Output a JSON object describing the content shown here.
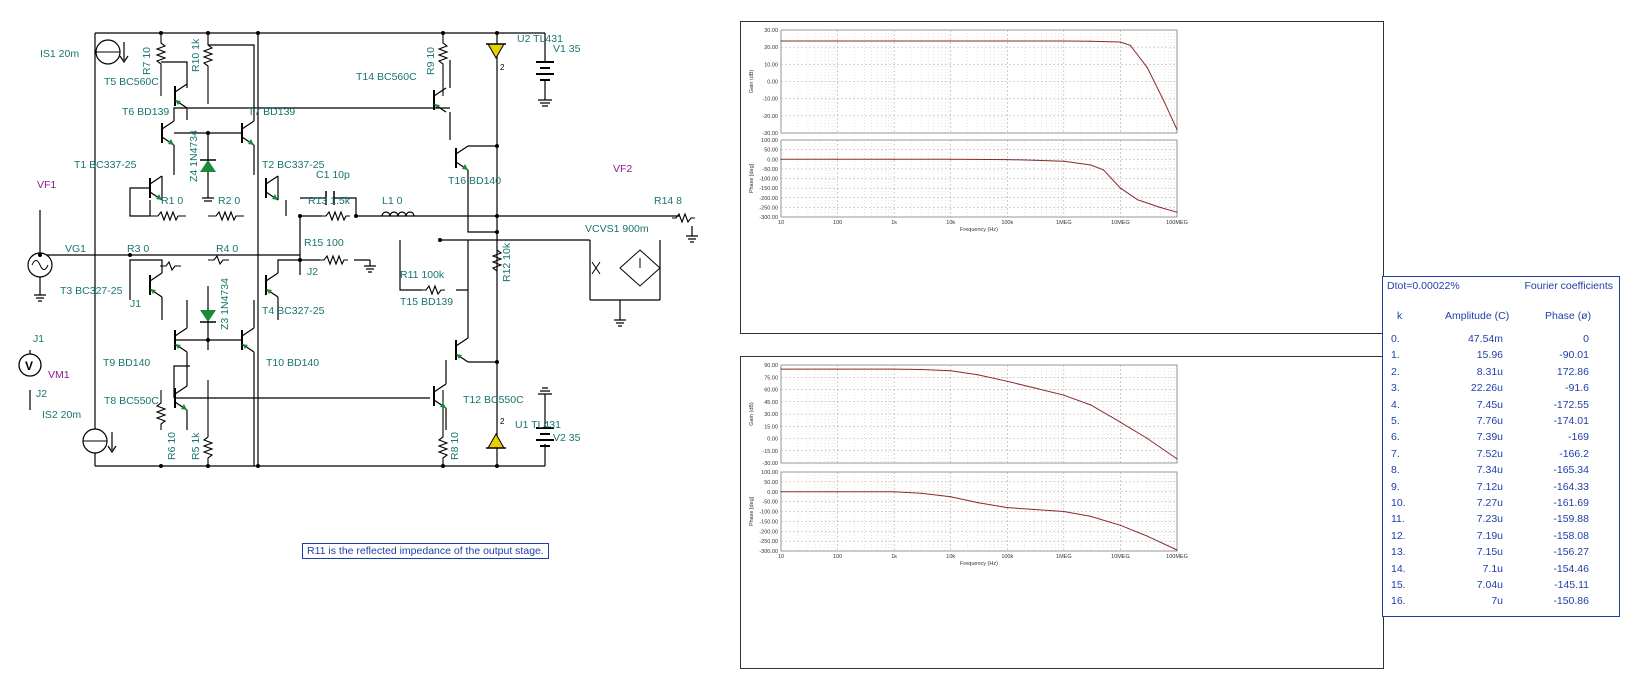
{
  "schematic": {
    "labels": {
      "is1": "IS1 20m",
      "is2": "IS2 20m",
      "r7": "R7 10",
      "r10": "R10 1k",
      "r9": "R9 10",
      "u2": "U2 TL431",
      "v1": "V1 35",
      "t5": "T5 BC560C",
      "t14": "T14 BC560C",
      "t6": "T6 BD139",
      "t7": "T7 BD139",
      "z4": "Z4 1N4734",
      "t1": "T1 BC337-25",
      "t2": "T2 BC337-25",
      "vf1": "VF1",
      "vf2": "VF2",
      "r1": "R1 0",
      "r2": "R2 0",
      "c1": "C1 10p",
      "r13": "R13 1.5k",
      "l1": "L1 0",
      "r14": "R14 8",
      "t16": "T16 BD140",
      "vg1": "VG1",
      "r3": "R3 0",
      "r4": "R4 0",
      "r15": "R15 100",
      "j2a": "J2",
      "vcvs": "VCVS1 900m",
      "r12": "R12 10k",
      "r11": "R11 100k",
      "t3": "T3 BC327-25",
      "z3": "Z3 1N4734",
      "t4": "T4 BC327-25",
      "j1a": "J1",
      "t15": "T15 BD139",
      "j1b": "J1",
      "vm1": "VM1",
      "vm_symbol": "V",
      "j2b": "J2",
      "t9": "T9 BD140",
      "t10": "T10 BD140",
      "t12": "T12 BC550C",
      "t8": "T8 BC550C",
      "u1": "U1 TL431",
      "v2": "V2 35",
      "r6": "R6 10",
      "r5": "R5 1k",
      "r8": "R8 10",
      "pin2a": "2",
      "pin2b": "2"
    },
    "note": "R11 is the reflected impedance of the output stage."
  },
  "bode_top": {
    "gain_label": "Gain (dB)",
    "phase_label": "Phase [deg]",
    "xlabel": "Frequency (Hz)",
    "x_ticks": [
      "10",
      "100",
      "1k",
      "10k",
      "100k",
      "1MEG",
      "10MEG",
      "100MEG"
    ],
    "gain_ticks": [
      "30.00",
      "20.00",
      "10.00",
      "0.00",
      "-10.00",
      "-20.00",
      "-30.00"
    ],
    "phase_ticks": [
      "100.00",
      "50.00",
      "0.00",
      "-50.00",
      "-100.00",
      "-150.00",
      "-200.00",
      "-250.00",
      "-300.00"
    ],
    "line_color": "#8b2a2a"
  },
  "bode_bottom": {
    "gain_label": "Gain (dB)",
    "phase_label": "Phase [deg]",
    "xlabel": "Frequency (Hz)",
    "x_ticks": [
      "10",
      "100",
      "1k",
      "10k",
      "100k",
      "1MEG",
      "10MEG",
      "100MEG"
    ],
    "gain_ticks": [
      "90.00",
      "75.00",
      "60.00",
      "45.00",
      "30.00",
      "15.00",
      "0.00",
      "-15.00",
      "-30.00"
    ],
    "phase_ticks": [
      "100.00",
      "50.00",
      "0.00",
      "-50.00",
      "-100.00",
      "-150.00",
      "-200.00",
      "-250.00",
      "-300.00"
    ],
    "line_color": "#8b2a2a"
  },
  "chart_data": [
    {
      "type": "line",
      "title": "",
      "xlabel": "Frequency (Hz)",
      "ylabel": "Gain (dB)",
      "xscale": "log",
      "xlim": [
        10,
        100000000
      ],
      "ylim": [
        -30,
        30
      ],
      "grid": true,
      "x": [
        10,
        100,
        1000,
        10000,
        100000,
        1000000,
        3000000,
        10000000,
        15000000,
        30000000,
        60000000,
        100000000
      ],
      "series": [
        {
          "values": [
            23.6,
            23.6,
            23.6,
            23.6,
            23.6,
            23.6,
            23.4,
            23.0,
            21.0,
            8.0,
            -12.0,
            -28.0
          ]
        }
      ]
    },
    {
      "type": "line",
      "title": "",
      "xlabel": "Frequency (Hz)",
      "ylabel": "Phase [deg]",
      "xscale": "log",
      "xlim": [
        10,
        100000000
      ],
      "ylim": [
        -300,
        100
      ],
      "grid": true,
      "x": [
        10,
        100,
        1000,
        10000,
        100000,
        300000,
        1000000,
        3000000,
        5000000,
        10000000,
        20000000,
        50000000,
        100000000
      ],
      "series": [
        {
          "values": [
            0,
            0,
            0,
            0,
            -2,
            -5,
            -10,
            -30,
            -55,
            -150,
            -210,
            -250,
            -275
          ]
        }
      ]
    },
    {
      "type": "line",
      "title": "",
      "xlabel": "Frequency (Hz)",
      "ylabel": "Gain (dB)",
      "xscale": "log",
      "xlim": [
        10,
        100000000
      ],
      "ylim": [
        -30,
        90
      ],
      "grid": true,
      "x": [
        10,
        100,
        1000,
        3000,
        10000,
        30000,
        100000,
        300000,
        1000000,
        3000000,
        10000000,
        30000000,
        100000000
      ],
      "series": [
        {
          "values": [
            85,
            85,
            85,
            84.5,
            83,
            78,
            70,
            62,
            53,
            41,
            20,
            0,
            -25
          ]
        }
      ]
    },
    {
      "type": "line",
      "title": "",
      "xlabel": "Frequency (Hz)",
      "ylabel": "Phase [deg]",
      "xscale": "log",
      "xlim": [
        10,
        100000000
      ],
      "ylim": [
        -300,
        100
      ],
      "grid": true,
      "x": [
        10,
        100,
        1000,
        3000,
        10000,
        30000,
        100000,
        300000,
        1000000,
        3000000,
        10000000,
        30000000,
        100000000
      ],
      "series": [
        {
          "values": [
            0,
            0,
            0,
            -8,
            -25,
            -55,
            -80,
            -90,
            -100,
            -125,
            -170,
            -225,
            -295
          ]
        }
      ]
    }
  ],
  "fourier": {
    "dtot": "Dtot=0.00022%",
    "title": "Fourier coefficients",
    "col_k": "k",
    "col_amp": "Amplitude (C)",
    "col_phase": "Phase (ø)",
    "rows": [
      {
        "k": "0.",
        "amp": "47.54m",
        "phase": "0"
      },
      {
        "k": "1.",
        "amp": "15.96",
        "phase": "-90.01"
      },
      {
        "k": "2.",
        "amp": "8.31u",
        "phase": "172.86"
      },
      {
        "k": "3.",
        "amp": "22.26u",
        "phase": "-91.6"
      },
      {
        "k": "4.",
        "amp": "7.45u",
        "phase": "-172.55"
      },
      {
        "k": "5.",
        "amp": "7.76u",
        "phase": "-174.01"
      },
      {
        "k": "6.",
        "amp": "7.39u",
        "phase": "-169"
      },
      {
        "k": "7.",
        "amp": "7.52u",
        "phase": "-166.2"
      },
      {
        "k": "8.",
        "amp": "7.34u",
        "phase": "-165.34"
      },
      {
        "k": "9.",
        "amp": "7.12u",
        "phase": "-164.33"
      },
      {
        "k": "10.",
        "amp": "7.27u",
        "phase": "-161.69"
      },
      {
        "k": "11.",
        "amp": "7.23u",
        "phase": "-159.88"
      },
      {
        "k": "12.",
        "amp": "7.19u",
        "phase": "-158.08"
      },
      {
        "k": "13.",
        "amp": "7.15u",
        "phase": "-156.27"
      },
      {
        "k": "14.",
        "amp": "7.1u",
        "phase": "-154.46"
      },
      {
        "k": "15.",
        "amp": "7.04u",
        "phase": "-145.11"
      },
      {
        "k": "16.",
        "amp": "7u",
        "phase": "-150.86"
      }
    ]
  }
}
